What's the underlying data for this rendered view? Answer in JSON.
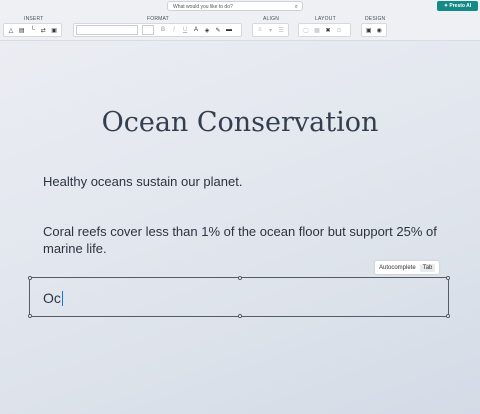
{
  "toolbar": {
    "search_placeholder": "What would you like to do?",
    "ai_button_label": "Presto AI",
    "groups": {
      "insert": "INSERT",
      "format": "FORMAT",
      "align": "ALIGN",
      "layout": "LAYOUT",
      "design": "DESIGN"
    },
    "format_buttons": {
      "bold": "B",
      "italic": "I",
      "underline": "U",
      "text_color": "A"
    }
  },
  "slide": {
    "title": "Ocean Conservation",
    "paragraph_1": "Healthy oceans sustain our planet.",
    "paragraph_2": "Coral reefs cover less than 1% of the ocean floor but support 25% of marine life.",
    "active_text": "Oc"
  },
  "autocomplete": {
    "label": "Autocomplete",
    "key": "Tab"
  },
  "colors": {
    "accent": "#138a86",
    "title": "#333f4e"
  }
}
